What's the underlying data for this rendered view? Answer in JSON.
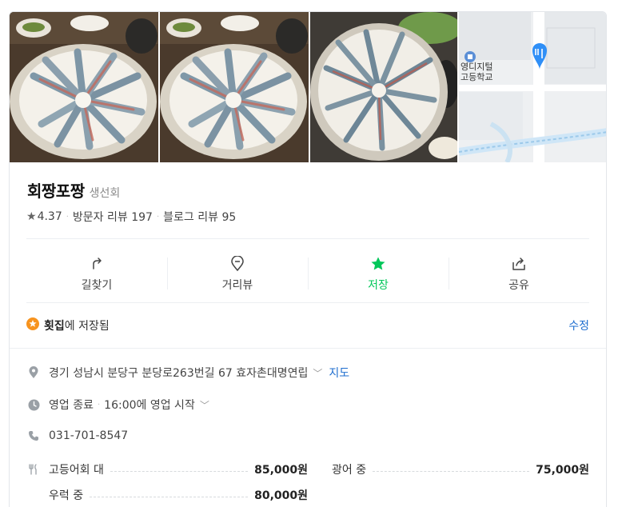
{
  "place": {
    "name": "회짱포짱",
    "category": "생선회",
    "rating": "4.37",
    "visitor_reviews": "방문자 리뷰 197",
    "blog_reviews": "블로그 리뷰 95"
  },
  "map_thumb": {
    "label_line1": "영디지털",
    "label_line2": "고등학교"
  },
  "actions": [
    {
      "label": "길찾기",
      "icon": "directions-icon"
    },
    {
      "label": "거리뷰",
      "icon": "location-pin-icon"
    },
    {
      "label": "저장",
      "icon": "star-icon"
    },
    {
      "label": "공유",
      "icon": "share-icon"
    }
  ],
  "saved": {
    "folder": "횟집",
    "text": "에 저장됨",
    "edit_label": "수정"
  },
  "info": {
    "address": "경기 성남시 분당구 분당로263번길 67 효자촌대명연립",
    "map_link": "지도",
    "hours_status": "영업 종료",
    "hours_detail": "16:00에 영업 시작",
    "phone": "031-701-8547"
  },
  "menu": [
    {
      "name": "고등어회 대",
      "price": "85,000원"
    },
    {
      "name": "광어 중",
      "price": "75,000원"
    },
    {
      "name": "우럭 중",
      "price": "80,000원"
    }
  ],
  "colors": {
    "accent_green": "#03c75a",
    "link_blue": "#1e6ecf",
    "badge_orange": "#f7931e",
    "map_pin_blue": "#2f8ff7"
  }
}
